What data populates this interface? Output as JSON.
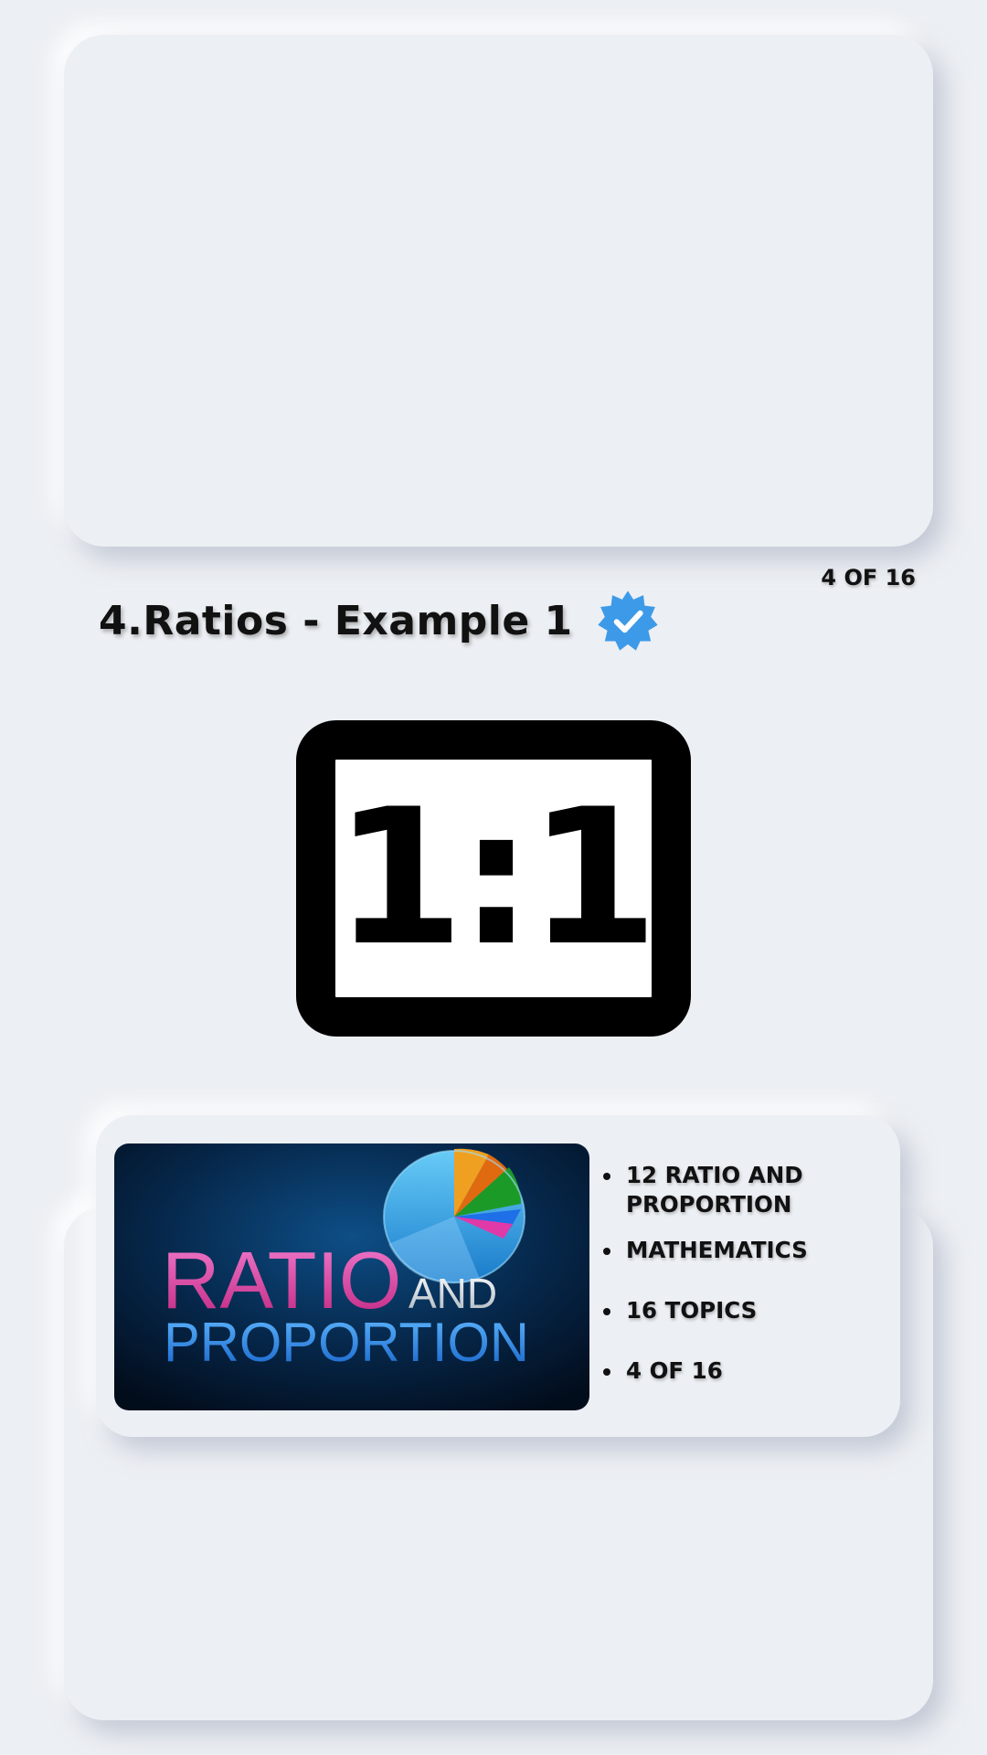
{
  "lesson": {
    "counter": "4 OF 16",
    "title": "4.Ratios - Example 1",
    "verified_badge_icon": "verified-check-icon",
    "ratio_display": "1:1",
    "ratio_icon": "aspect-ratio-1-1-icon"
  },
  "course_card": {
    "cover": {
      "word_ratio": "RATIO",
      "word_and": "AND",
      "word_proportion": "PROPORTION",
      "colors": {
        "ratio": "#e0409e",
        "and": "#d8dde2",
        "proportion": "#1f86e8",
        "background": "#041a33"
      }
    },
    "details": [
      "12 RATIO AND PROPORTION",
      "MATHEMATICS",
      "16 TOPICS",
      "4 OF 16"
    ]
  },
  "colors": {
    "page_background": "#eceff3",
    "badge_blue": "#3d9ae8",
    "text": "#111111"
  }
}
